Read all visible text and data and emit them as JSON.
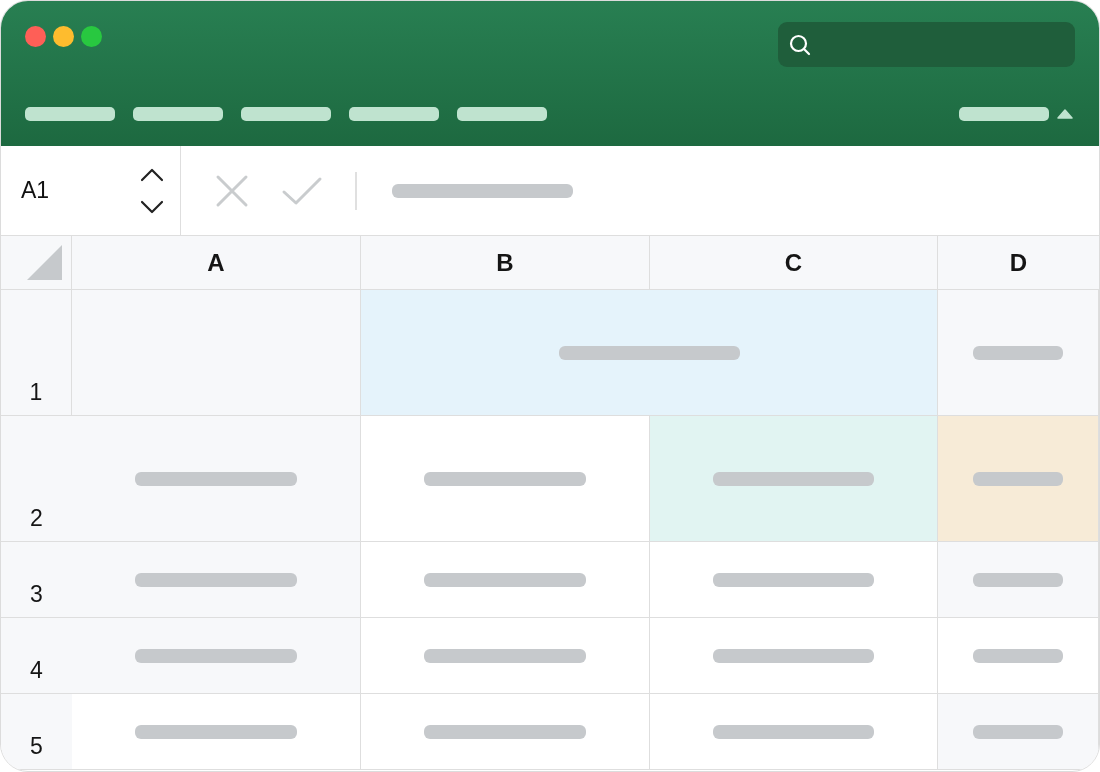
{
  "window": {
    "controls": [
      {
        "color": "#fe5f57"
      },
      {
        "color": "#febc2e"
      },
      {
        "color": "#28c840"
      }
    ]
  },
  "ribbon": {
    "tabs": [
      {
        "kind": "bar"
      },
      {
        "kind": "bar"
      },
      {
        "kind": "bar"
      },
      {
        "kind": "bar"
      },
      {
        "kind": "bar"
      }
    ],
    "toggle": {
      "kind": "bar",
      "expanded": true
    }
  },
  "formula_bar": {
    "name_box": "A1",
    "content": {
      "kind": "bar"
    },
    "actions_disabled": true
  },
  "sheet": {
    "columns": [
      "A",
      "B",
      "C",
      "D"
    ],
    "rows": [
      {
        "label": "1",
        "kind": "tall",
        "cells": [
          {
            "kind": "empty",
            "color": "#f7f8fa"
          },
          {
            "kind": "wide-bar",
            "color": "#e5f3fb"
          },
          {
            "kind": "bar",
            "color": "#f7f8fa"
          }
        ]
      },
      {
        "label": "2",
        "kind": "tall",
        "cells": [
          {
            "kind": "bar",
            "color": "#f7f8fa"
          },
          {
            "kind": "bar",
            "color": "#ffffff"
          },
          {
            "kind": "bar",
            "color": "#e1f4f2"
          },
          {
            "kind": "bar",
            "color": "#f7ebd7"
          }
        ]
      },
      {
        "label": "3",
        "kind": "short",
        "cells": [
          {
            "kind": "bar",
            "color": "#f7f8fa"
          },
          {
            "kind": "bar",
            "color": "#ffffff"
          },
          {
            "kind": "bar",
            "color": "#ffffff"
          },
          {
            "kind": "bar",
            "color": "#f7f8fa"
          }
        ]
      },
      {
        "label": "4",
        "kind": "short",
        "cells": [
          {
            "kind": "bar",
            "color": "#f7f8fa"
          },
          {
            "kind": "bar",
            "color": "#ffffff"
          },
          {
            "kind": "bar",
            "color": "#ffffff"
          },
          {
            "kind": "bar",
            "color": "#ffffff"
          }
        ]
      },
      {
        "label": "5",
        "kind": "short",
        "cells": [
          {
            "kind": "bar",
            "color": "#ffffff"
          },
          {
            "kind": "bar",
            "color": "#ffffff"
          },
          {
            "kind": "bar",
            "color": "#ffffff"
          },
          {
            "kind": "bar",
            "color": "#f7f8fa"
          }
        ]
      }
    ]
  }
}
